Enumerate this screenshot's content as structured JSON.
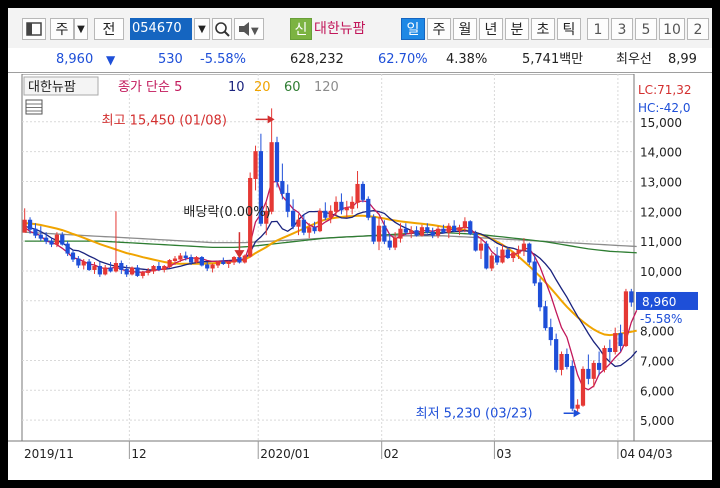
{
  "toolbar": {
    "market_label": "주",
    "prev_label": "전",
    "stock_code": "054670",
    "new_badge": "신",
    "stock_name": "대한뉴팜",
    "periods": [
      "일",
      "주",
      "월",
      "년",
      "분",
      "초",
      "틱"
    ],
    "active_period": "일",
    "counts": [
      "1",
      "3",
      "5",
      "10",
      "2"
    ],
    "colors": {
      "active_bg": "#1e88e5",
      "badge_bg": "#7cb342"
    }
  },
  "quote": {
    "price": "8,960",
    "change": "530",
    "change_pct": "-5.58%",
    "volume": "628,232",
    "vol_ratio": "62.70%",
    "turnover": "4.38%",
    "amount": "5,741백만",
    "best_offer_label": "최우선",
    "best_offer": "8,99",
    "down_color": "#1e4fd8"
  },
  "chart_data": {
    "type": "candlestick",
    "title": "대한뉴팜",
    "ma_label": "종가 단순 5",
    "ma_periods": [
      "5",
      "10",
      "20",
      "60",
      "120"
    ],
    "ma_colors": {
      "5": "#c2185b",
      "10": "#1a237e",
      "20": "#f0a400",
      "60": "#2e7d32",
      "120": "#8c8c8c"
    },
    "up_color": "#e53935",
    "down_color": "#1e4fd8",
    "ylim": [
      4300,
      16200
    ],
    "y_ticks": [
      5000,
      6000,
      7000,
      8000,
      9000,
      10000,
      11000,
      12000,
      13000,
      14000
    ],
    "y_tick_labels": [
      "5,000",
      "6,000",
      "7,000",
      "8,000",
      "9,000",
      "10,000",
      "11,000",
      "12,000",
      "13,000",
      "14,000",
      "15,000"
    ],
    "x_labels": [
      "2019/11",
      "12",
      "2020/01",
      "02",
      "03",
      "04",
      "04/03"
    ],
    "x_label_bars": [
      0,
      20,
      44,
      67,
      88,
      111,
      123
    ],
    "lc_label": "LC:71,32",
    "hc_label": "HC:-42,0",
    "current_price_label": "8,960",
    "current_change_label": "-5.58%",
    "current_price": 8960,
    "annotations": {
      "high": {
        "text": "최고 15,450 (01/08)",
        "value": 15450,
        "bar": 46
      },
      "low": {
        "text": "최저 5,230 (03/23)",
        "value": 5230,
        "bar": 103
      },
      "dividend": {
        "text": "배당락(0.00%)",
        "bar": 40
      }
    },
    "ohlc": [
      [
        11300,
        12100,
        11300,
        11700
      ],
      [
        11700,
        11800,
        11250,
        11400
      ],
      [
        11400,
        11600,
        11100,
        11200
      ],
      [
        11200,
        11500,
        11000,
        11100
      ],
      [
        11100,
        11300,
        10900,
        11000
      ],
      [
        11000,
        11100,
        10800,
        10900
      ],
      [
        10900,
        11300,
        10800,
        11200
      ],
      [
        11200,
        11300,
        10850,
        10900
      ],
      [
        10900,
        11000,
        10500,
        10600
      ],
      [
        10600,
        10700,
        10300,
        10400
      ],
      [
        10400,
        10500,
        10100,
        10200
      ],
      [
        10200,
        10400,
        10050,
        10300
      ],
      [
        10300,
        10400,
        10000,
        10050
      ],
      [
        10050,
        10300,
        9900,
        10150
      ],
      [
        10150,
        10300,
        9800,
        9900
      ],
      [
        9900,
        10200,
        9850,
        10100
      ],
      [
        10100,
        10300,
        9950,
        10000
      ],
      [
        10000,
        12000,
        9950,
        10250
      ],
      [
        10250,
        10350,
        9900,
        10050
      ],
      [
        10050,
        10200,
        9800,
        9900
      ],
      [
        9900,
        10150,
        9850,
        10100
      ],
      [
        10100,
        10200,
        9800,
        9850
      ],
      [
        9850,
        10000,
        9750,
        9950
      ],
      [
        9950,
        10100,
        9850,
        10000
      ],
      [
        10000,
        10200,
        9900,
        10150
      ],
      [
        10150,
        10300,
        10000,
        10050
      ],
      [
        10050,
        10200,
        9950,
        10150
      ],
      [
        10150,
        10400,
        10100,
        10350
      ],
      [
        10350,
        10500,
        10200,
        10400
      ],
      [
        10400,
        10600,
        10300,
        10500
      ],
      [
        10500,
        10650,
        10350,
        10450
      ],
      [
        10450,
        10550,
        10200,
        10300
      ],
      [
        10300,
        10500,
        10250,
        10450
      ],
      [
        10450,
        10500,
        10150,
        10200
      ],
      [
        10200,
        10300,
        10000,
        10100
      ],
      [
        10100,
        10250,
        9950,
        10200
      ],
      [
        10200,
        10350,
        10100,
        10300
      ],
      [
        10300,
        10450,
        10200,
        10250
      ],
      [
        10250,
        10350,
        10100,
        10300
      ],
      [
        10300,
        10500,
        10200,
        10450
      ],
      [
        10450,
        10600,
        10250,
        10300
      ],
      [
        10300,
        10550,
        10250,
        10500
      ],
      [
        10500,
        13300,
        10450,
        13100
      ],
      [
        13100,
        14200,
        12700,
        14000
      ],
      [
        14000,
        14600,
        11500,
        11600
      ],
      [
        11600,
        12300,
        11200,
        12000
      ],
      [
        12000,
        15450,
        11900,
        14300
      ],
      [
        14300,
        14500,
        12800,
        13000
      ],
      [
        13000,
        13600,
        12400,
        12600
      ],
      [
        12600,
        12900,
        11800,
        12000
      ],
      [
        12000,
        12400,
        11400,
        11500
      ],
      [
        11500,
        11900,
        11200,
        11700
      ],
      [
        11700,
        11900,
        11200,
        11300
      ],
      [
        11300,
        11600,
        11100,
        11450
      ],
      [
        11450,
        11650,
        11250,
        11350
      ],
      [
        11350,
        12100,
        11300,
        12000
      ],
      [
        12000,
        12300,
        11700,
        11800
      ],
      [
        11800,
        12200,
        11600,
        12000
      ],
      [
        12000,
        12500,
        11850,
        12300
      ],
      [
        12300,
        12600,
        11900,
        12050
      ],
      [
        12050,
        12350,
        11800,
        12100
      ],
      [
        12100,
        12500,
        11900,
        12300
      ],
      [
        12300,
        13350,
        12100,
        12900
      ],
      [
        12900,
        13000,
        12300,
        12400
      ],
      [
        12400,
        12500,
        11700,
        11800
      ],
      [
        11800,
        11900,
        10900,
        11000
      ],
      [
        11000,
        11800,
        10700,
        11500
      ],
      [
        11500,
        11700,
        10900,
        11000
      ],
      [
        11000,
        11250,
        10700,
        10800
      ],
      [
        10800,
        11300,
        10700,
        11100
      ],
      [
        11100,
        11600,
        10950,
        11400
      ],
      [
        11400,
        11600,
        11200,
        11300
      ],
      [
        11300,
        11500,
        11100,
        11350
      ],
      [
        11350,
        11500,
        11150,
        11200
      ],
      [
        11200,
        11550,
        11150,
        11450
      ],
      [
        11450,
        11600,
        11250,
        11300
      ],
      [
        11300,
        11450,
        11100,
        11200
      ],
      [
        11200,
        11500,
        11100,
        11400
      ],
      [
        11400,
        11550,
        11250,
        11300
      ],
      [
        11300,
        11600,
        11100,
        11500
      ],
      [
        11500,
        11700,
        11300,
        11350
      ],
      [
        11350,
        11550,
        11200,
        11450
      ],
      [
        11450,
        11800,
        11300,
        11650
      ],
      [
        11650,
        11700,
        11200,
        11250
      ],
      [
        11250,
        11350,
        10650,
        10700
      ],
      [
        10700,
        11100,
        10400,
        10900
      ],
      [
        10900,
        11000,
        10050,
        10100
      ],
      [
        10100,
        10600,
        10000,
        10500
      ],
      [
        10500,
        10800,
        10200,
        10300
      ],
      [
        10300,
        10900,
        10250,
        10700
      ],
      [
        10700,
        10800,
        10400,
        10450
      ],
      [
        10450,
        10650,
        10300,
        10600
      ],
      [
        10600,
        10850,
        10400,
        10700
      ],
      [
        10700,
        11100,
        10500,
        10900
      ],
      [
        10900,
        10950,
        10200,
        10300
      ],
      [
        10300,
        10500,
        9500,
        9600
      ],
      [
        9600,
        9750,
        8650,
        8800
      ],
      [
        8800,
        9000,
        8000,
        8100
      ],
      [
        8100,
        8400,
        7500,
        7700
      ],
      [
        7700,
        7900,
        6600,
        6700
      ],
      [
        6700,
        7300,
        6500,
        7200
      ],
      [
        7200,
        7400,
        6700,
        6800
      ],
      [
        6800,
        7000,
        5300,
        5400
      ],
      [
        5400,
        5700,
        5230,
        5500
      ],
      [
        5500,
        6800,
        5450,
        6700
      ],
      [
        6700,
        7200,
        6200,
        6400
      ],
      [
        6400,
        7000,
        6100,
        6900
      ],
      [
        6900,
        7300,
        6500,
        6700
      ],
      [
        6700,
        7500,
        6600,
        7400
      ],
      [
        7400,
        7700,
        7000,
        7300
      ],
      [
        7300,
        8100,
        7200,
        7900
      ],
      [
        7900,
        8200,
        7300,
        7500
      ],
      [
        7500,
        9400,
        7450,
        9300
      ],
      [
        9300,
        9400,
        8800,
        8960
      ]
    ],
    "ma": {
      "5": [
        11460,
        11320,
        11260,
        11180,
        11000,
        10960,
        10880,
        10760,
        10620,
        10440,
        10400,
        10320,
        10230,
        10200,
        10120,
        10080,
        10090,
        10130,
        10060,
        10000,
        9980,
        9960,
        9960,
        9980,
        10020,
        10040,
        10080,
        10150,
        10260,
        10340,
        10400,
        10440,
        10420,
        10410,
        10350,
        10320,
        10320,
        10330,
        10320,
        10330,
        10360,
        10400,
        10920,
        11640,
        11920,
        12340,
        12980,
        13000,
        12500,
        12300,
        12080,
        11960,
        11700,
        11540,
        11460,
        11510,
        11640,
        11740,
        11960,
        12080,
        12130,
        12150,
        12320,
        12350,
        12310,
        12090,
        11900,
        11540,
        11220,
        11080,
        11160,
        11240,
        11260,
        11300,
        11340,
        11360,
        11330,
        11380,
        11370,
        11380,
        11400,
        11420,
        11470,
        11430,
        11220,
        11080,
        10920,
        10650,
        10500,
        10440,
        10540,
        10540,
        10600,
        10740,
        10760,
        10480,
        10130,
        9660,
        9180,
        8620,
        8100,
        7780,
        7160,
        6520,
        6100,
        6020,
        6140,
        6540,
        6700,
        6880,
        7100,
        7280,
        7660,
        8280,
        8680
      ],
      "10": [
        11500,
        11450,
        11400,
        11320,
        11220,
        11100,
        11020,
        10940,
        10820,
        10700,
        10680,
        10600,
        10500,
        10420,
        10320,
        10260,
        10200,
        10160,
        10140,
        10110,
        10100,
        10080,
        10060,
        10040,
        10030,
        10050,
        10060,
        10080,
        10120,
        10160,
        10210,
        10250,
        10280,
        10310,
        10310,
        10320,
        10330,
        10340,
        10350,
        10360,
        10380,
        10400,
        10620,
        10980,
        11140,
        11340,
        11650,
        11660,
        11410,
        11330,
        11460,
        11720,
        11890,
        11990,
        11990,
        12000,
        11960,
        11920,
        11860,
        11780,
        11770,
        11800,
        11910,
        11970,
        12000,
        12020,
        11990,
        11930,
        11770,
        11630,
        11520,
        11440,
        11360,
        11260,
        11210,
        11210,
        11240,
        11260,
        11270,
        11310,
        11330,
        11330,
        11350,
        11330,
        11290,
        11240,
        11160,
        11050,
        10930,
        10850,
        10790,
        10760,
        10700,
        10680,
        10650,
        10560,
        10420,
        10240,
        10020,
        9700,
        9410,
        9120,
        8790,
        8480,
        8200,
        7900,
        7630,
        7400,
        7130,
        6950,
        6800,
        6830,
        6960,
        7110,
        7320
      ],
      "20": [
        11600,
        11590,
        11570,
        11540,
        11500,
        11460,
        11420,
        11370,
        11310,
        11240,
        11180,
        11110,
        11040,
        10970,
        10900,
        10840,
        10780,
        10720,
        10660,
        10600,
        10560,
        10510,
        10460,
        10420,
        10380,
        10340,
        10300,
        10270,
        10250,
        10240,
        10240,
        10240,
        10240,
        10240,
        10250,
        10260,
        10270,
        10280,
        10300,
        10320,
        10350,
        10380,
        10480,
        10600,
        10700,
        10800,
        10920,
        11020,
        11100,
        11180,
        11260,
        11340,
        11420,
        11500,
        11580,
        11660,
        11720,
        11760,
        11790,
        11810,
        11830,
        11840,
        11850,
        11850,
        11840,
        11820,
        11790,
        11760,
        11720,
        11690,
        11660,
        11640,
        11620,
        11600,
        11580,
        11560,
        11540,
        11510,
        11480,
        11460,
        11430,
        11400,
        11370,
        11330,
        11280,
        11220,
        11150,
        11070,
        10980,
        10880,
        10760,
        10630,
        10480,
        10320,
        10160,
        9990,
        9810,
        9620,
        9420,
        9210,
        9000,
        8800,
        8620,
        8450,
        8300,
        8160,
        8040,
        7940,
        7870,
        7850,
        7870,
        7900,
        7930,
        7960,
        8000
      ],
      "60": [
        11000,
        11000,
        11000,
        11000,
        11000,
        11000,
        11000,
        11000,
        11000,
        11000,
        11000,
        11000,
        11000,
        11000,
        11000,
        10990,
        10980,
        10970,
        10960,
        10950,
        10940,
        10930,
        10920,
        10910,
        10900,
        10890,
        10880,
        10870,
        10860,
        10850,
        10840,
        10830,
        10820,
        10810,
        10800,
        10790,
        10790,
        10790,
        10790,
        10790,
        10800,
        10810,
        10820,
        10840,
        10860,
        10880,
        10900,
        10920,
        10940,
        10960,
        10980,
        11000,
        11020,
        11040,
        11060,
        11080,
        11100,
        11110,
        11120,
        11130,
        11140,
        11150,
        11160,
        11170,
        11180,
        11190,
        11200,
        11210,
        11220,
        11230,
        11240,
        11250,
        11260,
        11270,
        11280,
        11290,
        11290,
        11290,
        11290,
        11280,
        11270,
        11260,
        11250,
        11240,
        11230,
        11220,
        11200,
        11180,
        11160,
        11140,
        11120,
        11100,
        11080,
        11060,
        11040,
        11020,
        11000,
        10980,
        10950,
        10920,
        10890,
        10860,
        10830,
        10800,
        10770,
        10740,
        10720,
        10700,
        10680,
        10660,
        10650,
        10640,
        10630,
        10620,
        10610
      ],
      "120": [
        11300,
        11290,
        11280,
        11270,
        11260,
        11250,
        11240,
        11230,
        11220,
        11210,
        11200,
        11190,
        11180,
        11170,
        11160,
        11150,
        11140,
        11130,
        11120,
        11110,
        11100,
        11090,
        11080,
        11070,
        11060,
        11050,
        11040,
        11030,
        11020,
        11010,
        11000,
        10990,
        10980,
        10970,
        10960,
        10950,
        10950,
        10950,
        10950,
        10950,
        10950,
        10950,
        10960,
        10970,
        10980,
        10990,
        11000,
        11010,
        11020,
        11030,
        11040,
        11050,
        11060,
        11070,
        11080,
        11090,
        11100,
        11110,
        11120,
        11130,
        11140,
        11150,
        11160,
        11170,
        11180,
        11180,
        11180,
        11180,
        11180,
        11180,
        11180,
        11180,
        11180,
        11180,
        11180,
        11180,
        11180,
        11180,
        11180,
        11170,
        11160,
        11150,
        11140,
        11130,
        11120,
        11110,
        11100,
        11090,
        11080,
        11070,
        11060,
        11050,
        11040,
        11030,
        11020,
        11010,
        11000,
        10990,
        10980,
        10970,
        10960,
        10950,
        10940,
        10930,
        10920,
        10910,
        10900,
        10890,
        10880,
        10870,
        10860,
        10850,
        10840,
        10830,
        10820
      ]
    }
  }
}
